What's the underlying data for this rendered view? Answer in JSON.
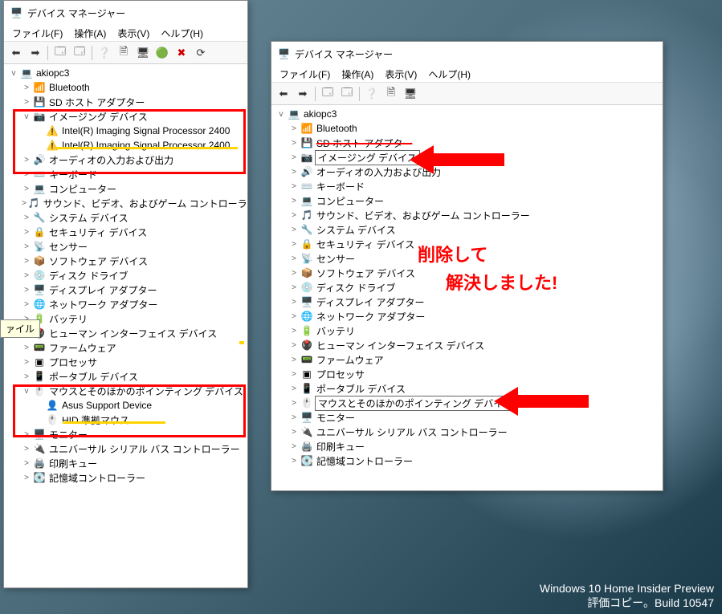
{
  "window_title": "デバイス マネージャー",
  "menus": {
    "file": "ファイル(F)",
    "action": "操作(A)",
    "view": "表示(V)",
    "help": "ヘルプ(H)"
  },
  "tooltip_file": "ァイル",
  "computer": "akiopc3",
  "tree1": [
    {
      "lvl": 1,
      "tw": ">",
      "ico": "bt",
      "lbl": "Bluetooth"
    },
    {
      "lvl": 1,
      "tw": ">",
      "ico": "sd",
      "lbl": "SD ホスト アダプター"
    },
    {
      "lvl": 1,
      "tw": "v",
      "ico": "cam",
      "lbl": "イメージング デバイス"
    },
    {
      "lvl": 2,
      "tw": "",
      "ico": "warn",
      "lbl": "Intel(R) Imaging Signal Processor 2400"
    },
    {
      "lvl": 2,
      "tw": "",
      "ico": "warn",
      "lbl": "Intel(R) Imaging Signal Processor 2400"
    },
    {
      "lvl": 1,
      "tw": ">",
      "ico": "aud",
      "lbl": "オーディオの入力および出力"
    },
    {
      "lvl": 1,
      "tw": ">",
      "ico": "kbd",
      "lbl": "キーボード"
    },
    {
      "lvl": 1,
      "tw": ">",
      "ico": "pc",
      "lbl": "コンピューター"
    },
    {
      "lvl": 1,
      "tw": ">",
      "ico": "snd",
      "lbl": "サウンド、ビデオ、およびゲーム コントローラー"
    },
    {
      "lvl": 1,
      "tw": ">",
      "ico": "sys",
      "lbl": "システム デバイス"
    },
    {
      "lvl": 1,
      "tw": ">",
      "ico": "sec",
      "lbl": "セキュリティ デバイス"
    },
    {
      "lvl": 1,
      "tw": ">",
      "ico": "sen",
      "lbl": "センサー"
    },
    {
      "lvl": 1,
      "tw": ">",
      "ico": "sw",
      "lbl": "ソフトウェア デバイス"
    },
    {
      "lvl": 1,
      "tw": ">",
      "ico": "dsk",
      "lbl": "ディスク ドライブ"
    },
    {
      "lvl": 1,
      "tw": ">",
      "ico": "disp",
      "lbl": "ディスプレイ アダプター"
    },
    {
      "lvl": 1,
      "tw": ">",
      "ico": "net",
      "lbl": "ネットワーク アダプター"
    },
    {
      "lvl": 1,
      "tw": ">",
      "ico": "bat",
      "lbl": "バッテリ"
    },
    {
      "lvl": 1,
      "tw": ">",
      "ico": "hid",
      "lbl": "ヒューマン インターフェイス デバイス"
    },
    {
      "lvl": 1,
      "tw": ">",
      "ico": "fw",
      "lbl": "ファームウェア"
    },
    {
      "lvl": 1,
      "tw": ">",
      "ico": "cpu",
      "lbl": "プロセッサ"
    },
    {
      "lvl": 1,
      "tw": ">",
      "ico": "prt",
      "lbl": "ポータブル デバイス",
      "fade": true
    },
    {
      "lvl": 1,
      "tw": "v",
      "ico": "mou",
      "lbl": "マウスとそのほかのポインティング デバイス"
    },
    {
      "lvl": 2,
      "tw": "",
      "ico": "asus",
      "lbl": "Asus Support Device"
    },
    {
      "lvl": 2,
      "tw": "",
      "ico": "mou",
      "lbl": "HID 準拠マウス"
    },
    {
      "lvl": 1,
      "tw": ">",
      "ico": "mon",
      "lbl": "モニター"
    },
    {
      "lvl": 1,
      "tw": ">",
      "ico": "usb",
      "lbl": "ユニバーサル シリアル バス コントローラー"
    },
    {
      "lvl": 1,
      "tw": ">",
      "ico": "prn",
      "lbl": "印刷キュー"
    },
    {
      "lvl": 1,
      "tw": ">",
      "ico": "mem",
      "lbl": "記憶域コントローラー"
    }
  ],
  "tree2": [
    {
      "lvl": 1,
      "tw": ">",
      "ico": "bt",
      "lbl": "Bluetooth"
    },
    {
      "lvl": 1,
      "tw": ">",
      "ico": "sd",
      "lbl": "SD ホスト アダプター",
      "strike": true
    },
    {
      "lvl": 1,
      "tw": ">",
      "ico": "cam",
      "lbl": "イメージング デバイス",
      "box": true
    },
    {
      "lvl": 1,
      "tw": ">",
      "ico": "aud",
      "lbl": "オーディオの入力および出力"
    },
    {
      "lvl": 1,
      "tw": ">",
      "ico": "kbd",
      "lbl": "キーボード"
    },
    {
      "lvl": 1,
      "tw": ">",
      "ico": "pc",
      "lbl": "コンピューター"
    },
    {
      "lvl": 1,
      "tw": ">",
      "ico": "snd",
      "lbl": "サウンド、ビデオ、およびゲーム コントローラー"
    },
    {
      "lvl": 1,
      "tw": ">",
      "ico": "sys",
      "lbl": "システム デバイス"
    },
    {
      "lvl": 1,
      "tw": ">",
      "ico": "sec",
      "lbl": "セキュリティ デバイス"
    },
    {
      "lvl": 1,
      "tw": ">",
      "ico": "sen",
      "lbl": "センサー"
    },
    {
      "lvl": 1,
      "tw": ">",
      "ico": "sw",
      "lbl": "ソフトウェア デバイス"
    },
    {
      "lvl": 1,
      "tw": ">",
      "ico": "dsk",
      "lbl": "ディスク ドライブ"
    },
    {
      "lvl": 1,
      "tw": ">",
      "ico": "disp",
      "lbl": "ディスプレイ アダプター"
    },
    {
      "lvl": 1,
      "tw": ">",
      "ico": "net",
      "lbl": "ネットワーク アダプター"
    },
    {
      "lvl": 1,
      "tw": ">",
      "ico": "bat",
      "lbl": "バッテリ"
    },
    {
      "lvl": 1,
      "tw": ">",
      "ico": "hid",
      "lbl": "ヒューマン インターフェイス デバイス"
    },
    {
      "lvl": 1,
      "tw": ">",
      "ico": "fw",
      "lbl": "ファームウェア"
    },
    {
      "lvl": 1,
      "tw": ">",
      "ico": "cpu",
      "lbl": "プロセッサ"
    },
    {
      "lvl": 1,
      "tw": ">",
      "ico": "prt",
      "lbl": "ポータブル デバイス"
    },
    {
      "lvl": 1,
      "tw": ">",
      "ico": "mou",
      "lbl": "マウスとそのほかのポインティング デバイス",
      "box": true
    },
    {
      "lvl": 1,
      "tw": ">",
      "ico": "mon",
      "lbl": "モニター"
    },
    {
      "lvl": 1,
      "tw": ">",
      "ico": "usb",
      "lbl": "ユニバーサル シリアル バス コントローラー"
    },
    {
      "lvl": 1,
      "tw": ">",
      "ico": "prn",
      "lbl": "印刷キュー"
    },
    {
      "lvl": 1,
      "tw": ">",
      "ico": "mem",
      "lbl": "記憶域コントローラー"
    }
  ],
  "annotation": {
    "line1": "削除して",
    "line2": "解決しました!"
  },
  "watermark": {
    "line1": "Windows 10 Home Insider Preview",
    "line2": "評価コピー。Build 10547"
  }
}
